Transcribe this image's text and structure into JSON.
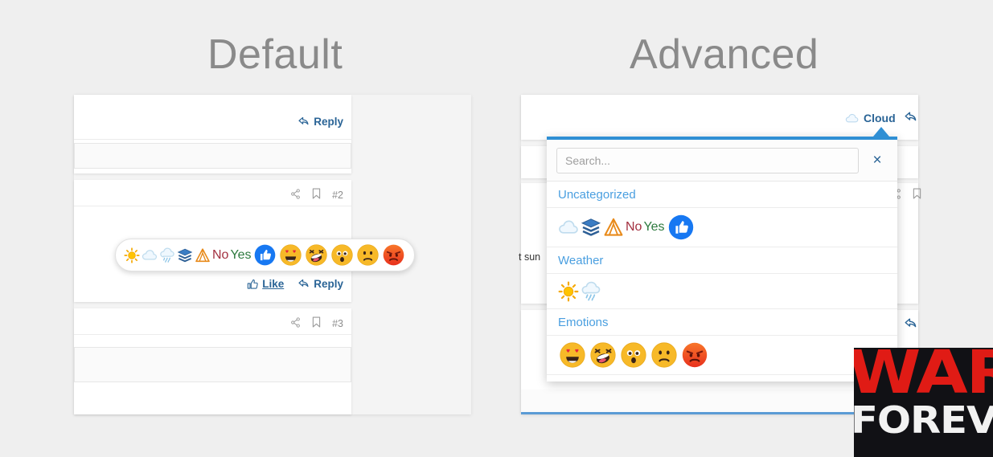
{
  "headings": {
    "left": "Default",
    "right": "Advanced"
  },
  "default_panel": {
    "posts": [
      {
        "id": "post-1",
        "reply_label": "Reply"
      },
      {
        "id": "post-2",
        "number": "#2",
        "like_label": "Like",
        "reply_label": "Reply"
      },
      {
        "id": "post-3",
        "number": "#3"
      }
    ],
    "reaction_bar": {
      "items": [
        {
          "name": "sun-icon",
          "kind": "icon",
          "label": "sun"
        },
        {
          "name": "cloud-icon",
          "kind": "icon",
          "label": "cloud"
        },
        {
          "name": "rain-cloud-icon",
          "kind": "icon",
          "label": "rain"
        },
        {
          "name": "layers-icon",
          "kind": "icon",
          "label": "layers"
        },
        {
          "name": "tent-icon",
          "kind": "icon",
          "label": "tent"
        },
        {
          "name": "no-text",
          "kind": "text",
          "label": "No",
          "color": "#a33040"
        },
        {
          "name": "yes-text",
          "kind": "text",
          "label": "Yes",
          "color": "#2d7a3e"
        },
        {
          "name": "thumbs-up-icon",
          "kind": "face",
          "label": "like"
        },
        {
          "name": "heart-eyes-icon",
          "kind": "face",
          "label": "love"
        },
        {
          "name": "rofl-icon",
          "kind": "face",
          "label": "haha"
        },
        {
          "name": "shocked-icon",
          "kind": "face",
          "label": "wow"
        },
        {
          "name": "frowning-icon",
          "kind": "face",
          "label": "sad"
        },
        {
          "name": "angry-icon",
          "kind": "face",
          "label": "angry"
        }
      ]
    }
  },
  "advanced_panel": {
    "cloud_tag": "Cloud",
    "clipped_text": "t sun",
    "picker": {
      "search_placeholder": "Search...",
      "close_label": "×",
      "categories": [
        {
          "title": "Uncategorized",
          "items": [
            {
              "name": "cloud-icon",
              "kind": "icon",
              "label": "cloud"
            },
            {
              "name": "layers-icon",
              "kind": "icon",
              "label": "layers"
            },
            {
              "name": "tent-icon",
              "kind": "icon",
              "label": "tent"
            },
            {
              "name": "no-text",
              "kind": "text",
              "label": "No",
              "color": "#a33040"
            },
            {
              "name": "yes-text",
              "kind": "text",
              "label": "Yes",
              "color": "#2d7a3e"
            },
            {
              "name": "thumbs-up-icon",
              "kind": "face",
              "label": "like"
            }
          ]
        },
        {
          "title": "Weather",
          "items": [
            {
              "name": "sun-icon",
              "kind": "icon",
              "label": "sun"
            },
            {
              "name": "rain-cloud-icon",
              "kind": "icon",
              "label": "rain"
            }
          ]
        },
        {
          "title": "Emotions",
          "items": [
            {
              "name": "heart-eyes-icon",
              "kind": "face",
              "label": "love"
            },
            {
              "name": "rofl-icon",
              "kind": "face",
              "label": "haha"
            },
            {
              "name": "shocked-icon",
              "kind": "face",
              "label": "wow"
            },
            {
              "name": "frowning-icon",
              "kind": "face",
              "label": "sad"
            },
            {
              "name": "angry-icon",
              "kind": "face",
              "label": "angry"
            }
          ]
        }
      ]
    }
  },
  "watermark": {
    "line1": "WAR",
    "line2": "FOREVER"
  },
  "colors": {
    "link": "#2a6496",
    "accent": "#2f8fd4",
    "category": "#4a9fe0",
    "page_bg": "#efefef",
    "no": "#a33040",
    "yes": "#2d7a3e"
  }
}
